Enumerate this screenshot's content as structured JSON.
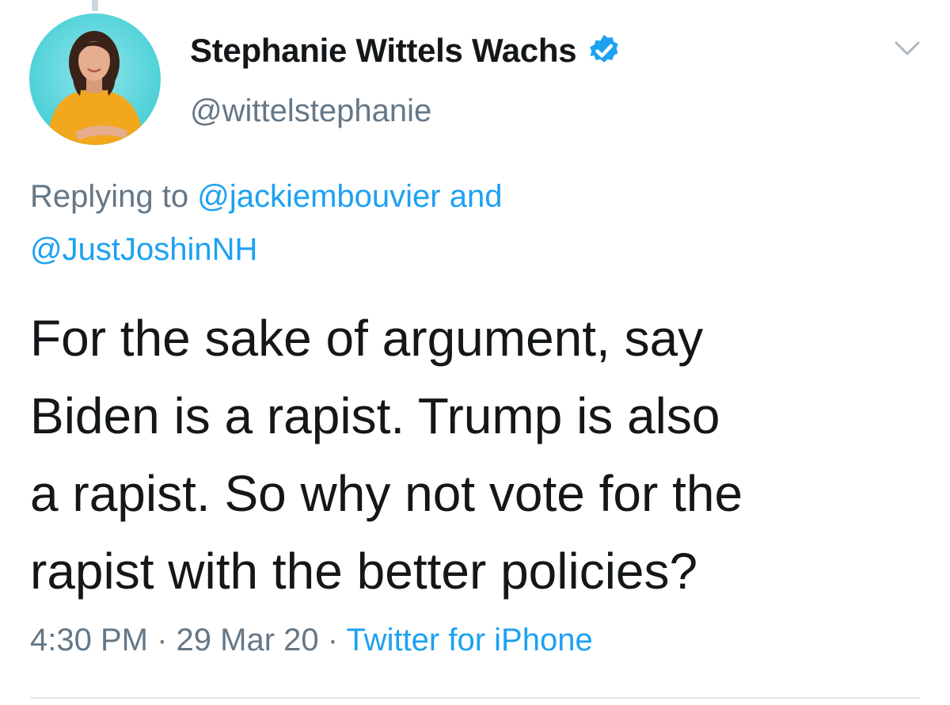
{
  "tweet": {
    "author": {
      "display_name": "Stephanie Wittels Wachs",
      "handle": "@wittelstephanie",
      "verified": true,
      "verified_color": "#1da1f2"
    },
    "reply": {
      "prefix": "Replying to ",
      "mention_1": "@jackiembouvier",
      "conjunction": " and",
      "mention_2": "@JustJoshinNH"
    },
    "text_lines": [
      "For the sake of argument, say",
      "Biden is a rapist. Trump is also",
      "a rapist. So why not vote for the",
      "rapist with the better policies?"
    ],
    "meta": {
      "time": "4:30 PM",
      "separator": " · ",
      "date": "29 Mar 20",
      "source": "Twitter for iPhone"
    }
  },
  "icons": {
    "menu": "chevron-down-icon",
    "verified": "verified-badge-icon"
  },
  "colors": {
    "text_primary": "#14171a",
    "text_secondary": "#657786",
    "link": "#1da1f2",
    "divider": "#e1e8ed"
  }
}
